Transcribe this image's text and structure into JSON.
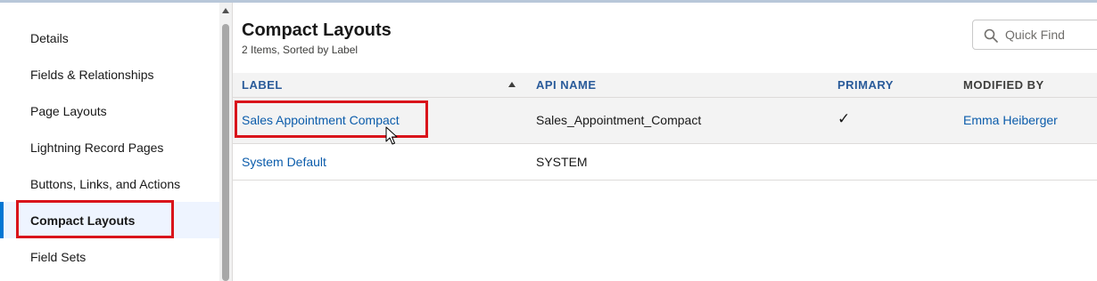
{
  "sidebar": {
    "items": [
      {
        "label": "Details",
        "active": false
      },
      {
        "label": "Fields & Relationships",
        "active": false
      },
      {
        "label": "Page Layouts",
        "active": false
      },
      {
        "label": "Lightning Record Pages",
        "active": false
      },
      {
        "label": "Buttons, Links, and Actions",
        "active": false
      },
      {
        "label": "Compact Layouts",
        "active": true
      },
      {
        "label": "Field Sets",
        "active": false
      }
    ]
  },
  "header": {
    "title": "Compact Layouts",
    "subtitle": "2 Items, Sorted by Label"
  },
  "search": {
    "placeholder": "Quick Find"
  },
  "table": {
    "columns": [
      "LABEL",
      "API NAME",
      "PRIMARY",
      "MODIFIED BY"
    ],
    "sorted_column": "LABEL",
    "sort_direction": "ascending",
    "rows": [
      {
        "label": "Sales Appointment Compact",
        "api_name": "Sales_Appointment_Compact",
        "primary": "✓",
        "modified_by": "Emma Heiberger"
      },
      {
        "label": "System Default",
        "api_name": "SYSTEM",
        "primary": "",
        "modified_by": ""
      }
    ]
  },
  "colors": {
    "link": "#0b5cab",
    "header_text": "#2a5b9a",
    "highlight": "#d9141b",
    "active_bar": "#0176d3"
  }
}
